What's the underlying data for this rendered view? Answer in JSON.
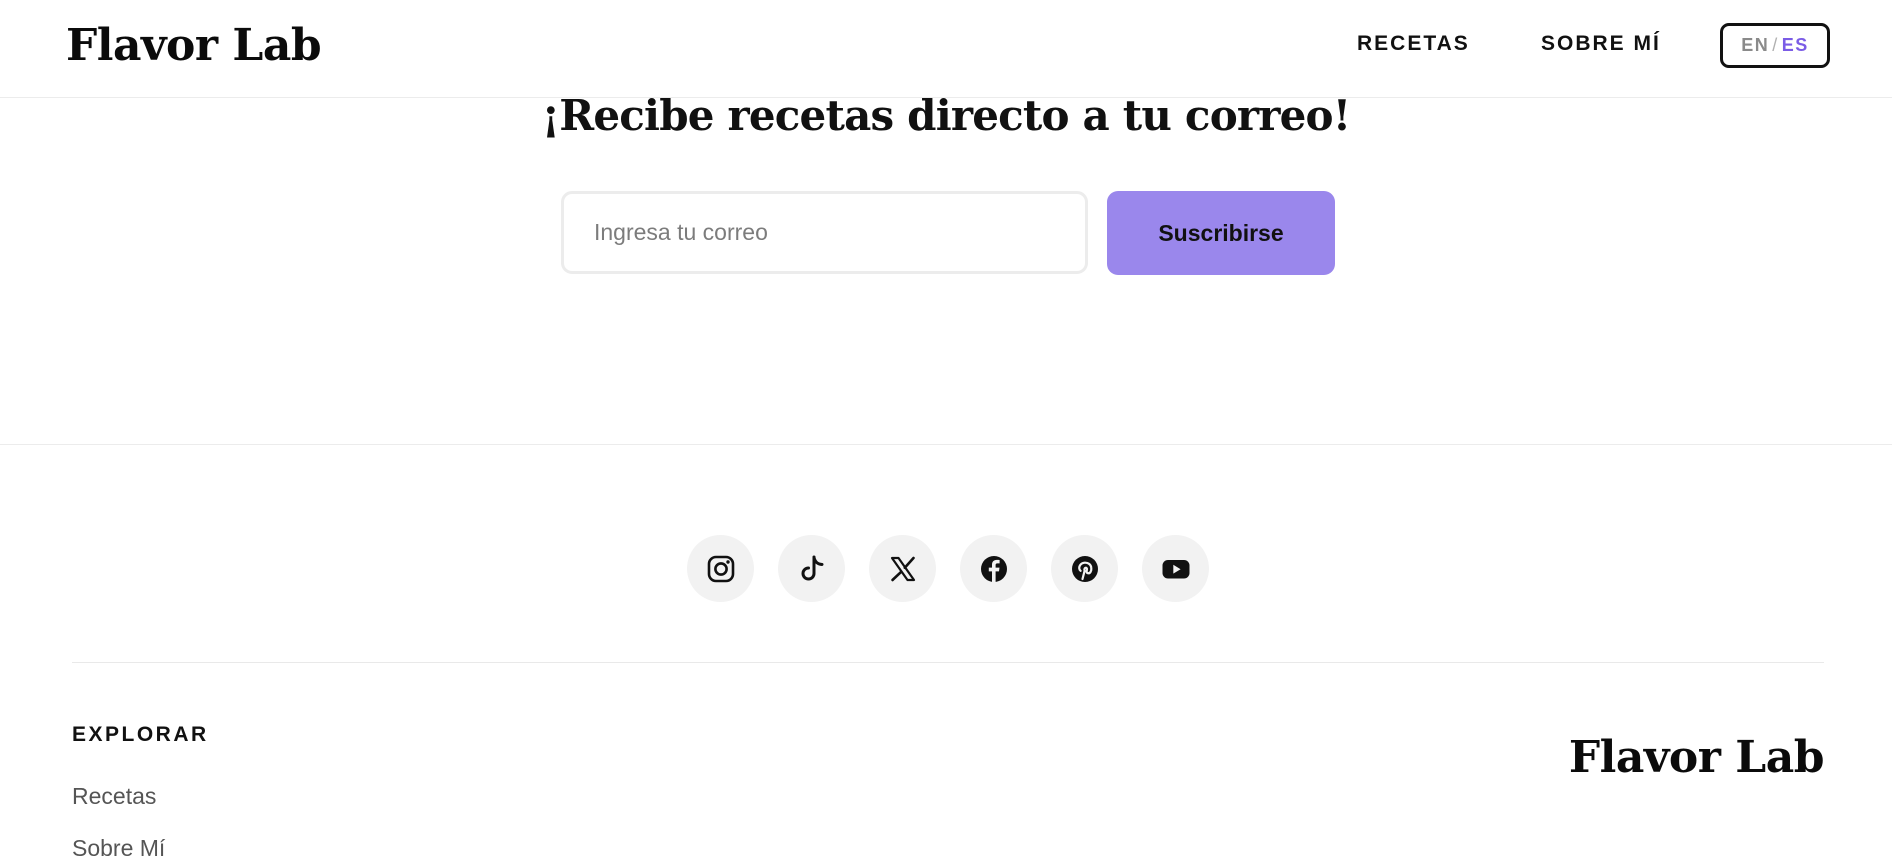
{
  "header": {
    "logo": "Flavor Lab",
    "nav": [
      {
        "label": "RECETAS"
      },
      {
        "label": "SOBRE MÍ"
      }
    ],
    "language_toggle": {
      "en": "EN",
      "separator": "/",
      "es": "ES",
      "active": "ES",
      "active_color": "#7b5ce6"
    }
  },
  "newsletter": {
    "title": "¡Recibe recetas directo a tu correo!",
    "email_placeholder": "Ingresa tu correo",
    "email_value": "",
    "subscribe_label": "Suscribirse",
    "button_color": "#9a87ec"
  },
  "social": {
    "icons": [
      "instagram-icon",
      "tiktok-icon",
      "x-icon",
      "facebook-icon",
      "pinterest-icon",
      "youtube-icon"
    ]
  },
  "footer": {
    "explore_heading": "EXPLORAR",
    "links": [
      {
        "label": "Recetas"
      },
      {
        "label": "Sobre Mí"
      }
    ],
    "logo": "Flavor Lab"
  }
}
